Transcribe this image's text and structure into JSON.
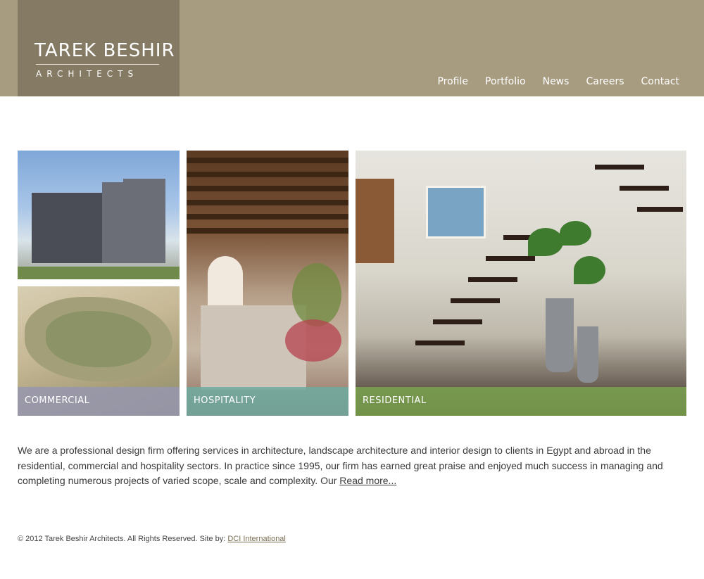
{
  "header": {
    "logo_name": "TAREK BESHIR",
    "logo_sub": "ARCHITECTS",
    "nav": [
      "Profile",
      "Portfolio",
      "News",
      "Careers",
      "Contact"
    ]
  },
  "tiles": {
    "commercial": "COMMERCIAL",
    "hospitality": "HOSPITALITY",
    "residential": "RESIDENTIAL"
  },
  "description": {
    "text": "We are a professional design firm offering services in architecture, landscape architecture and interior design to clients in Egypt and abroad in the residential, commercial and hospitality sectors.  In practice since 1995, our firm has earned great praise and enjoyed much success in managing and completing numerous projects of varied scope, scale and complexity. Our ",
    "link": "Read more..."
  },
  "footer": {
    "text": "© 2012 Tarek Beshir Architects. All Rights Reserved. Site by: ",
    "link": "DCI International"
  },
  "colors": {
    "header_bg": "#a89c80",
    "logo_bg": "#857a64",
    "commercial_label": "#9696af",
    "hospitality_label": "#6eaaa0",
    "residential_label": "#7aa050"
  }
}
